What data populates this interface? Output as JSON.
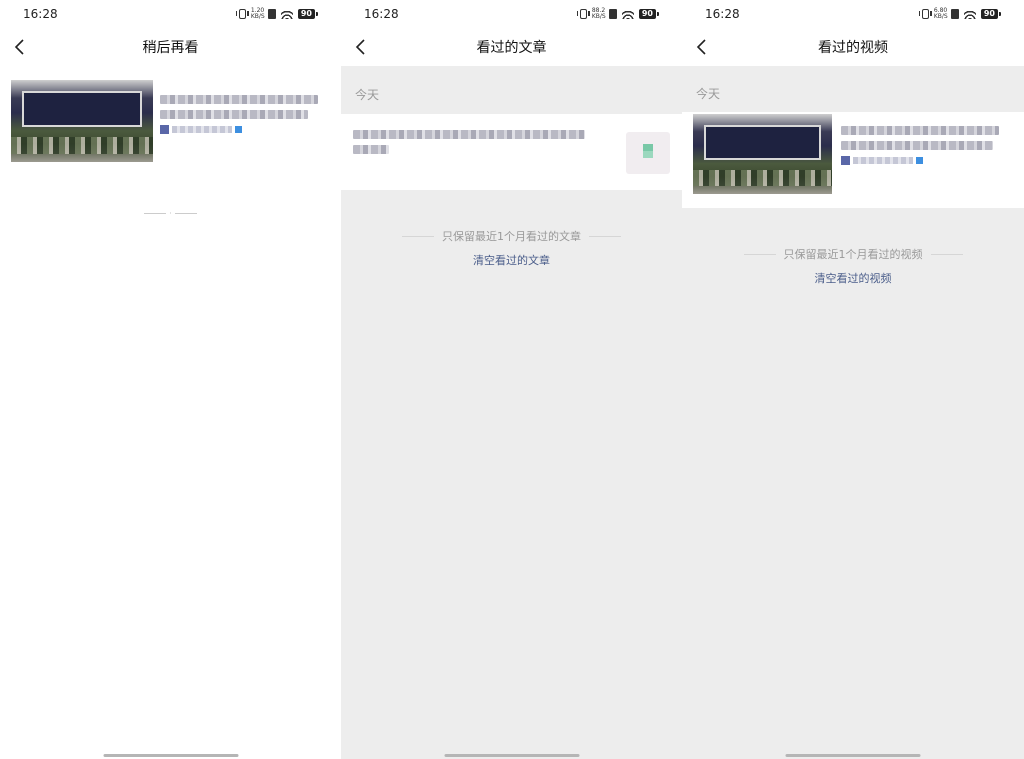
{
  "status": {
    "time": "16:28",
    "battery": "90",
    "netspeed1": "1.20\nKB/S",
    "netspeed2": "88.2\nKB/S",
    "netspeed3": "6.80\nKB/S"
  },
  "screens": {
    "later": {
      "title": "稍后再看"
    },
    "articles": {
      "title": "看过的文章",
      "section": "今天",
      "note": "只保留最近1个月看过的文章",
      "clear": "清空看过的文章"
    },
    "videos": {
      "title": "看过的视频",
      "section": "今天",
      "note": "只保留最近1个月看过的视频",
      "clear": "清空看过的视频"
    }
  },
  "icons": {
    "back": "chevron-left-icon"
  },
  "colors": {
    "link": "#4a5d8a",
    "muted": "#999999",
    "page_bg": "#ededed"
  }
}
